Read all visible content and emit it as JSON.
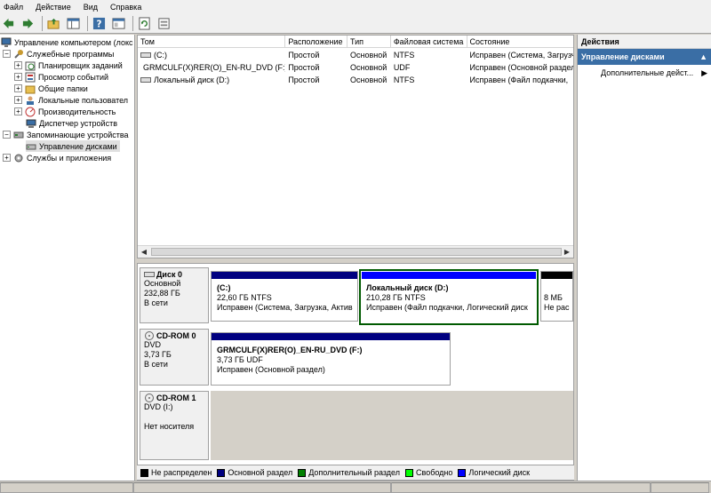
{
  "menu": [
    "Файл",
    "Действие",
    "Вид",
    "Справка"
  ],
  "toolbar": {
    "icons": [
      "back-arrow-icon",
      "forward-arrow-icon",
      "up-folder-icon",
      "show-hide-tree-icon",
      "help-icon",
      "properties-icon",
      "refresh-icon",
      "export-icon"
    ]
  },
  "tree": {
    "items": [
      {
        "label": "Управление компьютером (локс",
        "level": 0,
        "expander": "",
        "icon": "computer-management-icon"
      },
      {
        "label": "Служебные программы",
        "level": 1,
        "expander": "−",
        "icon": "tools-icon"
      },
      {
        "label": "Планировщик заданий",
        "level": 2,
        "expander": "+",
        "icon": "task-scheduler-icon"
      },
      {
        "label": "Просмотр событий",
        "level": 2,
        "expander": "+",
        "icon": "event-viewer-icon"
      },
      {
        "label": "Общие папки",
        "level": 2,
        "expander": "+",
        "icon": "shared-folders-icon"
      },
      {
        "label": "Локальные пользовател",
        "level": 2,
        "expander": "+",
        "icon": "local-users-icon"
      },
      {
        "label": "Производительность",
        "level": 2,
        "expander": "+",
        "icon": "performance-icon"
      },
      {
        "label": "Диспетчер устройств",
        "level": 2,
        "expander": "",
        "icon": "device-manager-icon"
      },
      {
        "label": "Запоминающие устройства",
        "level": 1,
        "expander": "−",
        "icon": "storage-icon"
      },
      {
        "label": "Управление дисками",
        "level": 2,
        "expander": "",
        "icon": "disk-management-icon",
        "selected": true
      },
      {
        "label": "Службы и приложения",
        "level": 1,
        "expander": "+",
        "icon": "services-icon"
      }
    ]
  },
  "volume_list": {
    "columns": [
      "Том",
      "Расположение",
      "Тип",
      "Файловая система",
      "Состояние"
    ],
    "rows": [
      [
        "(C:)",
        "Простой",
        "Основной",
        "NTFS",
        "Исправен (Система, Загрузч"
      ],
      [
        "GRMCULF(X)RER(O)_EN-RU_DVD (F:)",
        "Простой",
        "Основной",
        "UDF",
        "Исправен (Основной раздел"
      ],
      [
        "Локальный диск  (D:)",
        "Простой",
        "Основной",
        "NTFS",
        "Исправен (Файл подкачки,"
      ]
    ]
  },
  "disks": [
    {
      "name": "Диск 0",
      "lines": [
        "Основной",
        "232,88 ГБ",
        "В сети"
      ],
      "partitions": [
        {
          "title": "(C:)",
          "size": "22,60 ГБ NTFS",
          "status": "Исправен (Система, Загрузка, Актив",
          "color": "#000080"
        },
        {
          "title": "Локальный диск   (D:)",
          "size": "210,28 ГБ NTFS",
          "status": "Исправен (Файл подкачки, Логический диск",
          "color": "#0000ff",
          "selected": true
        },
        {
          "title": "",
          "size": "8 МБ",
          "status": "Не рас",
          "color": "#000000"
        }
      ]
    },
    {
      "name": "CD-ROM 0",
      "lines": [
        "DVD",
        "3,73 ГБ",
        "В сети"
      ],
      "partitions": [
        {
          "title": "GRMCULF(X)RER(O)_EN-RU_DVD  (F:)",
          "size": "3,73 ГБ UDF",
          "status": "Исправен (Основной раздел)",
          "color": "#000080"
        }
      ]
    },
    {
      "name": "CD-ROM 1",
      "lines": [
        "DVD (I:)",
        "",
        "Нет носителя"
      ],
      "partitions": []
    }
  ],
  "legend": [
    {
      "label": "Не распределен",
      "color": "#000000"
    },
    {
      "label": "Основной раздел",
      "color": "#000080"
    },
    {
      "label": "Дополнительный раздел",
      "color": "#008000"
    },
    {
      "label": "Свободно",
      "color": "#00ff00"
    },
    {
      "label": "Логический диск",
      "color": "#0000ff"
    }
  ],
  "actions": {
    "header": "Действия",
    "section": "Управление дисками",
    "items": [
      "Дополнительные дейст..."
    ]
  }
}
